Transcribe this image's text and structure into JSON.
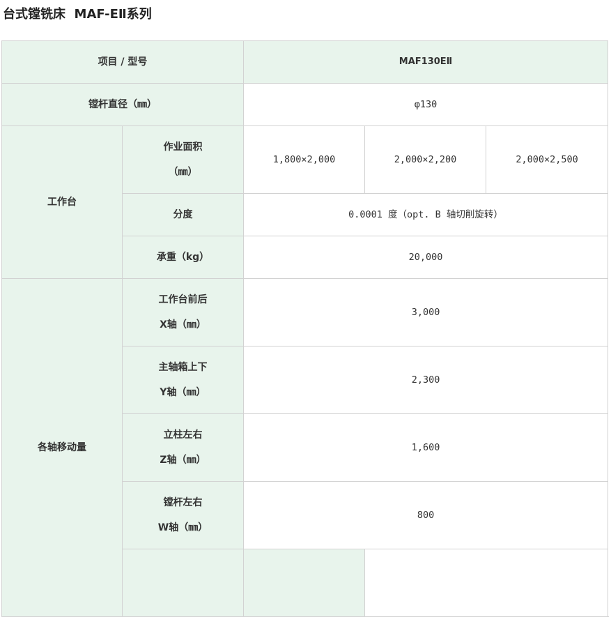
{
  "page": {
    "title": "台式镗铣床  MAF-EⅡ系列"
  },
  "colors": {
    "label_bg": "#e8f4ec",
    "border": "#d2d2d2",
    "text": "#333333"
  },
  "table": {
    "header": {
      "item_label": "项目 / 型号",
      "model": "MAF130EⅡ"
    },
    "spindle": {
      "label": "镗杆直径（㎜）",
      "value": "φ130"
    },
    "worktable": {
      "group_label": "工作台",
      "area": {
        "label_line1": "作业面积",
        "label_line2": "（㎜）",
        "values": [
          "1,800×2,000",
          "2,000×2,200",
          "2,000×2,500"
        ]
      },
      "indexing": {
        "label": "分度",
        "value": "0.0001 度（opt. B 轴切削旋转）"
      },
      "load": {
        "label": "承重（kg）",
        "value": "20,000"
      }
    },
    "travel": {
      "group_label": "各轴移动量",
      "x": {
        "label_line1": "工作台前后",
        "label_line2": "X轴（㎜）",
        "value": "3,000"
      },
      "y": {
        "label_line1": "主轴箱上下",
        "label_line2": "Y轴（㎜）",
        "value": "2,300"
      },
      "z": {
        "label_line1": "立柱左右",
        "label_line2": "Z轴（㎜）",
        "value": "1,600"
      },
      "w": {
        "label_line1": "镗杆左右",
        "label_line2": "W轴（㎜）",
        "value": "800"
      }
    }
  }
}
